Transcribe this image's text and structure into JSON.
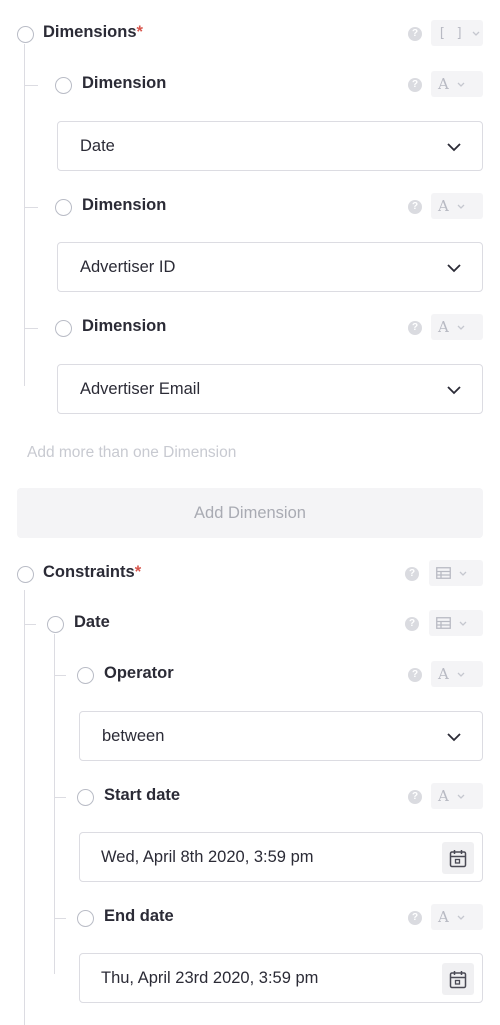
{
  "dimensions": {
    "label": "Dimensions",
    "required_mark": "*",
    "type_glyph": "[ ]",
    "items": [
      {
        "label": "Dimension",
        "type_glyph": "A",
        "value": "Date"
      },
      {
        "label": "Dimension",
        "type_glyph": "A",
        "value": "Advertiser ID"
      },
      {
        "label": "Dimension",
        "type_glyph": "A",
        "value": "Advertiser Email"
      }
    ],
    "hint": "Add more than one Dimension",
    "add_button": "Add Dimension"
  },
  "constraints": {
    "label": "Constraints",
    "required_mark": "*",
    "date": {
      "label": "Date",
      "operator": {
        "label": "Operator",
        "type_glyph": "A",
        "value": "between"
      },
      "start_date": {
        "label": "Start date",
        "type_glyph": "A",
        "value": "Wed, April 8th 2020, 3:59 pm"
      },
      "end_date": {
        "label": "End date",
        "type_glyph": "A",
        "value": "Thu, April 23rd 2020, 3:59 pm"
      }
    }
  },
  "icons": {
    "help": "question-circle-icon",
    "chevron": "chevron-down-icon",
    "table": "table-icon",
    "calendar": "calendar-icon"
  },
  "colors": {
    "text": "#2b2b36",
    "required": "#d7544b",
    "muted": "#c8cad1",
    "border": "#dcdce2"
  }
}
